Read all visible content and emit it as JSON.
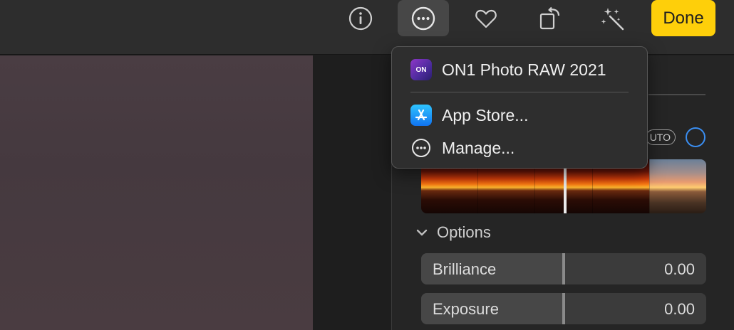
{
  "toolbar": {
    "buttons": [
      {
        "name": "info-icon"
      },
      {
        "name": "more-options-icon",
        "active": true
      },
      {
        "name": "heart-icon"
      },
      {
        "name": "rotate-crop-icon"
      },
      {
        "name": "magic-wand-icon"
      }
    ],
    "done_label": "Done",
    "accent_color": "#fecf0a"
  },
  "menu": {
    "items": [
      {
        "label": "ON1 Photo RAW 2021",
        "icon": "on1-app-icon",
        "icon_text": "ON"
      },
      {
        "label": "App Store...",
        "icon": "app-store-icon"
      },
      {
        "label": "Manage...",
        "icon": "ellipsis-circle-icon"
      }
    ]
  },
  "panel": {
    "auto_label": "UTO",
    "auto_accent": "#3a8ef2",
    "options_label": "Options",
    "sliders": [
      {
        "label": "Brilliance",
        "value": "0.00",
        "level": 0.5
      },
      {
        "label": "Exposure",
        "value": "0.00",
        "level": 0.5
      }
    ]
  }
}
